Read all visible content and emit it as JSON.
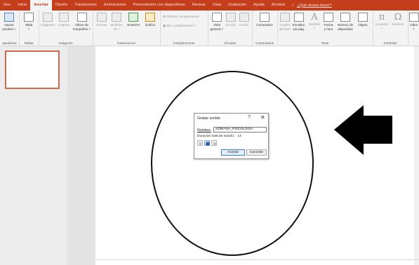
{
  "tabs": [
    "hivo",
    "Inicio",
    "Insertar",
    "Diseño",
    "Transiciones",
    "Animaciones",
    "Presentación con diapositivas",
    "Revisar",
    "Vista",
    "Grabación",
    "Ayuda",
    "Acrobat"
  ],
  "tell_me": "¿Qué desea hacer?",
  "ribbon": {
    "slides_btn": [
      "Nueva",
      "positiva ˅"
    ],
    "slides_label": "apositivas",
    "table_btn": [
      "Tabla",
      "˅"
    ],
    "tables_label": "Tablas",
    "images_btn": "Imágenes",
    "capture_btn": "Captura",
    "album_btn": [
      "Álbum de",
      "fotografías ˅"
    ],
    "images_label": "Imágenes",
    "shapes_btn": "Formas",
    "models_btn": [
      "Modelos",
      "3D ˅"
    ],
    "smartart_btn": "SmartArt",
    "chart_btn": "Gráfico",
    "illustrations_label": "Ilustraciones",
    "get_addins": "Obtener complementos",
    "my_addins": "Mis complementos ˅",
    "addins_label": "Complementos",
    "zoom_btn": [
      "Vista",
      "general ˅"
    ],
    "link_btn": "Vínculo",
    "action_btn": "Acción",
    "links_label": "Vínculos",
    "comment_btn": "Comentario",
    "comments_label": "Comentarios",
    "textbox_btn": [
      "Cuadro",
      "de texto"
    ],
    "header_btn": [
      "Encabez.",
      "pie pág."
    ],
    "wordart_btn": [
      "WordArt",
      "˅"
    ],
    "datetime_btn": [
      "Fecha",
      "y hora"
    ],
    "slidenum_btn": [
      "Número de",
      "diapositiva"
    ],
    "object_btn": "Objeto",
    "text_label": "Texto",
    "equation_btn": [
      "Ecuación",
      "˅"
    ],
    "symbol_btn": "Símbolo",
    "symbols_label": "Símbolos",
    "video_btn": [
      "Video",
      "˅"
    ]
  },
  "dialog": {
    "title": "Grabar sonido",
    "help": "?",
    "close": "✕",
    "name_label": "Nombre:",
    "name_value": "ADRIANA_PSICOLOGIA",
    "duration_label": "Duración total de sonido:",
    "duration_value": "13",
    "ok": "Aceptar",
    "cancel": "Cancelar"
  }
}
